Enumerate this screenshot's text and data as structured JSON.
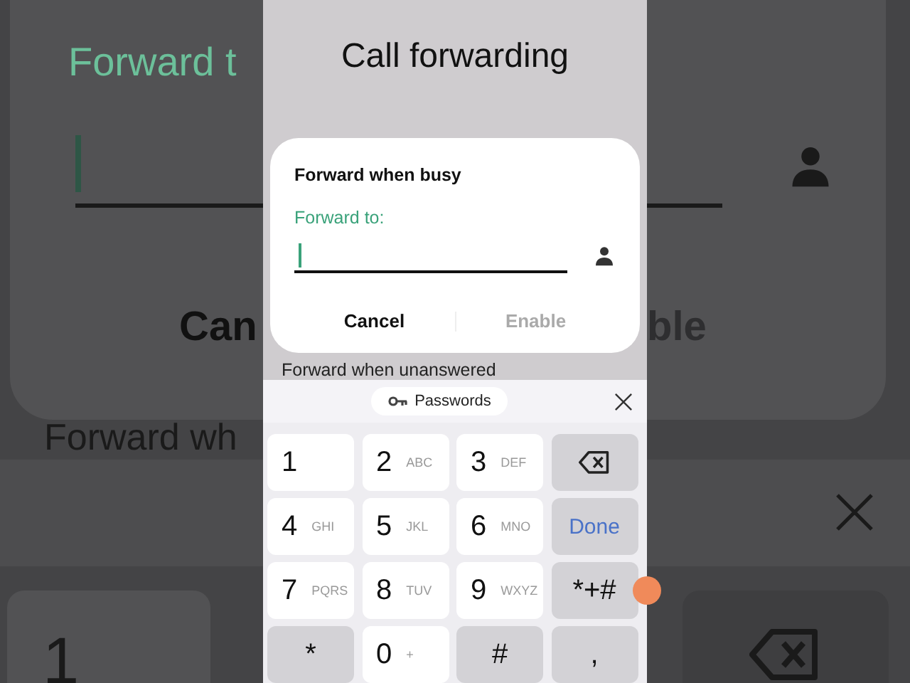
{
  "screen": {
    "title": "Call forwarding",
    "dialog": {
      "title": "Forward when busy",
      "field_label": "Forward to:",
      "focused": true,
      "buttons": [
        {
          "label": "Cancel",
          "disabled": false
        },
        {
          "label": "Enable",
          "disabled": true
        }
      ]
    },
    "list_item": "Forward when unanswered",
    "keyboard": {
      "suggestion": "Passwords",
      "keys": [
        {
          "kind": "digit",
          "label": "1"
        },
        {
          "kind": "digit",
          "label": "2",
          "letters": "ABC"
        },
        {
          "kind": "digit",
          "label": "3",
          "letters": "DEF"
        },
        {
          "kind": "backspace"
        },
        {
          "kind": "digit",
          "label": "4",
          "letters": "GHI"
        },
        {
          "kind": "digit",
          "label": "5",
          "letters": "JKL"
        },
        {
          "kind": "digit",
          "label": "6",
          "letters": "MNO"
        },
        {
          "kind": "action",
          "label": "Done"
        },
        {
          "kind": "digit",
          "label": "7",
          "letters": "PQRS"
        },
        {
          "kind": "digit",
          "label": "8",
          "letters": "TUV"
        },
        {
          "kind": "digit",
          "label": "9",
          "letters": "WXYZ"
        },
        {
          "kind": "symbol",
          "label": "*+#"
        },
        {
          "kind": "symbol",
          "label": "*"
        },
        {
          "kind": "digit",
          "label": "0",
          "letters": "+"
        },
        {
          "kind": "symbol",
          "label": "#"
        },
        {
          "kind": "symbol",
          "label": ","
        }
      ]
    }
  },
  "backdrop": {
    "left": {
      "field_label": "Forward t",
      "button": "Can",
      "list_item": "Forward wh",
      "key": "1"
    },
    "right": {
      "button": "ble"
    }
  }
}
